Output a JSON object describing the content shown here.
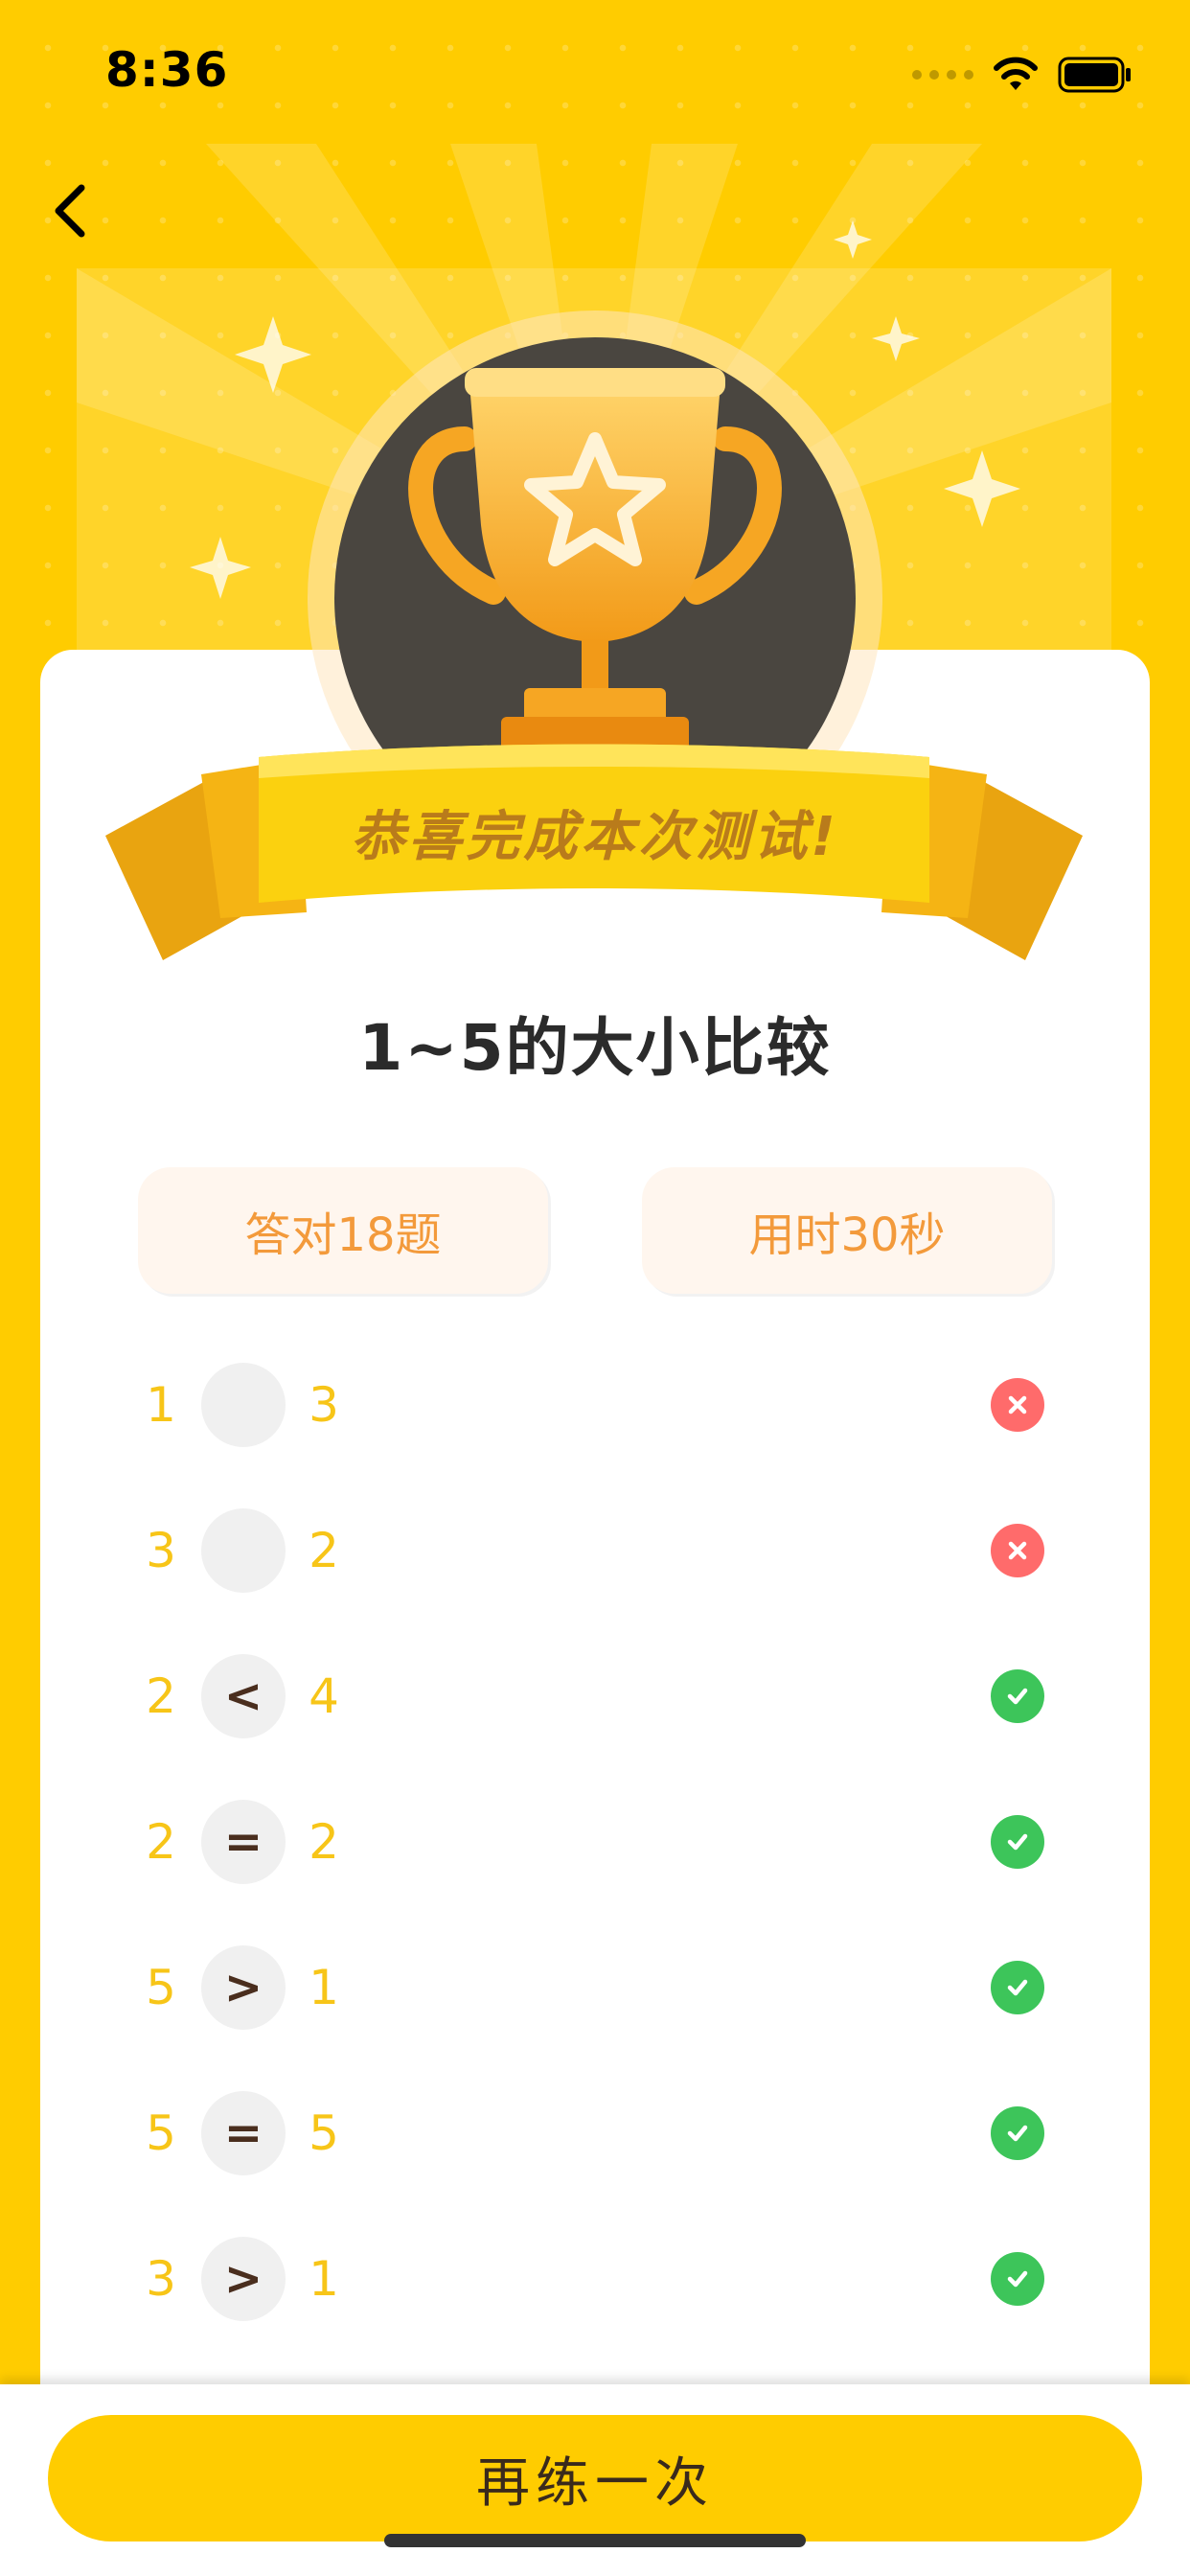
{
  "status_bar": {
    "time": "8:36",
    "icons": [
      "signal-dots-icon",
      "wifi-icon",
      "battery-icon"
    ]
  },
  "nav": {
    "back_icon": "chevron-left-icon"
  },
  "banner": {
    "congrats_text": "恭喜完成本次测试!",
    "trophy_icon": "trophy-star-icon"
  },
  "quiz": {
    "title": "1~5的大小比较",
    "correct_label": "答对18题",
    "time_label": "用时30秒",
    "rows": [
      {
        "left": "1",
        "operator": "",
        "right": "3",
        "result": "wrong"
      },
      {
        "left": "3",
        "operator": "",
        "right": "2",
        "result": "wrong"
      },
      {
        "left": "2",
        "operator": "<",
        "right": "4",
        "result": "correct"
      },
      {
        "left": "2",
        "operator": "=",
        "right": "2",
        "result": "correct"
      },
      {
        "left": "5",
        "operator": ">",
        "right": "1",
        "result": "correct"
      },
      {
        "left": "5",
        "operator": "=",
        "right": "5",
        "result": "correct"
      },
      {
        "left": "3",
        "operator": ">",
        "right": "1",
        "result": "correct"
      }
    ]
  },
  "footer": {
    "retry_label": "再练一次"
  },
  "colors": {
    "background": "#FFCC00",
    "number_text": "#F7C518",
    "correct": "#3DC55A",
    "wrong": "#FF6B6B",
    "stat_text": "#F39A3B"
  }
}
